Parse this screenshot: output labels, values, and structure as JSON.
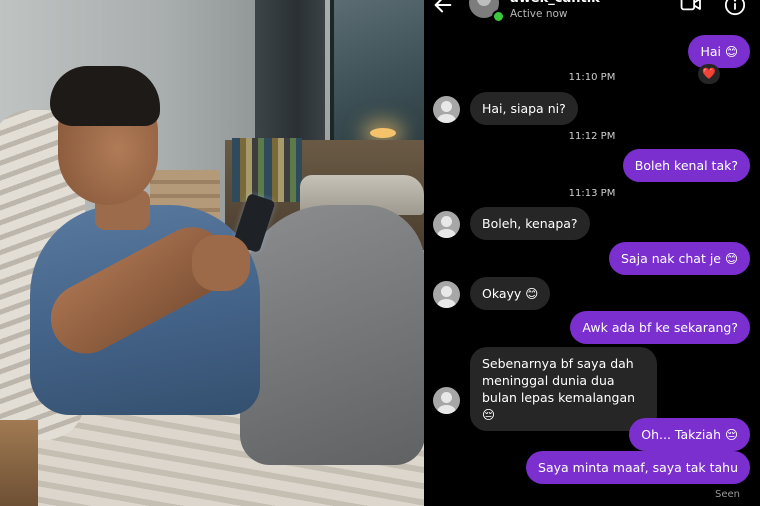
{
  "header": {
    "username": "awek_cantik",
    "status": "Active now",
    "back_icon": "arrow-left-icon",
    "video_icon": "video-camera-icon",
    "info_icon": "info-circle-icon",
    "online_color": "#3cc83c"
  },
  "colors": {
    "outgoing_bubble": "#7b2fcf",
    "incoming_bubble": "#262626",
    "background": "#000000"
  },
  "messages": {
    "m1": "Hai 😊",
    "m1_reaction": "❤️",
    "ts1": "11:10 PM",
    "m2": "Hai, siapa ni?",
    "ts2": "11:12 PM",
    "m3": "Boleh kenal tak?",
    "ts3": "11:13 PM",
    "m4": "Boleh, kenapa?",
    "m5": "Saja nak chat je 😊",
    "m6": "Okayy 😊",
    "m7": "Awk ada bf ke sekarang?",
    "m8": "Sebenarnya bf saya dah meninggal dunia dua bulan lepas kemalangan 😔",
    "m9": "Oh... Takziah 😔",
    "m10": "Saya minta maaf, saya tak tahu",
    "seen": "Seen"
  }
}
